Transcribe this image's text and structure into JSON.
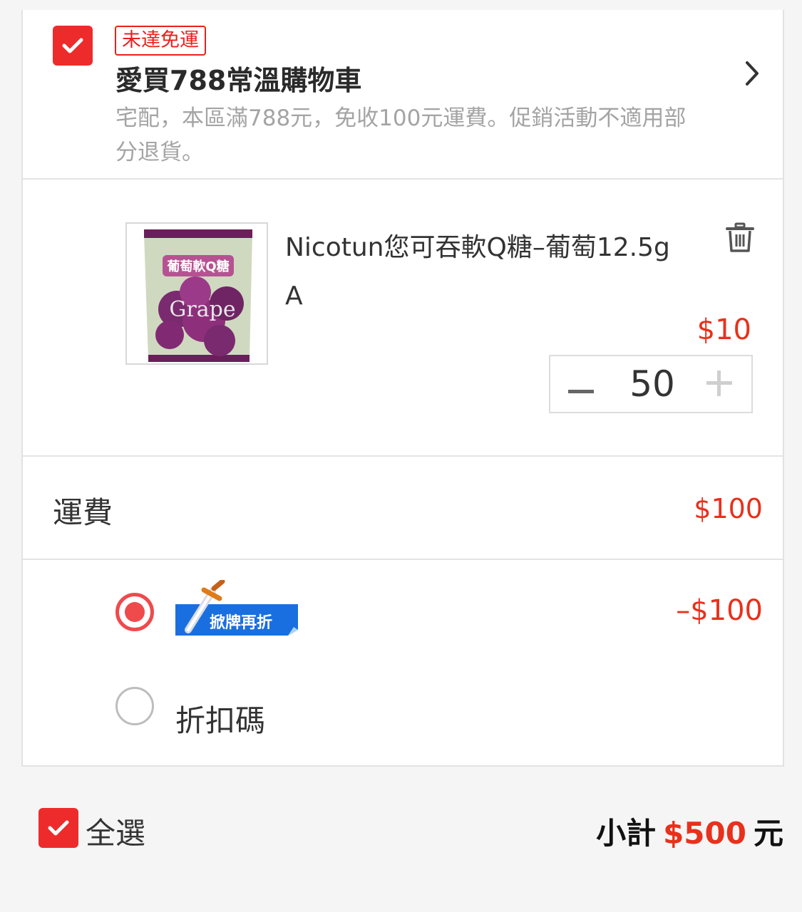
{
  "store": {
    "tag": "未達免運",
    "title": "愛買788常溫購物車",
    "description": "宅配，本區滿788元，免收100元運費。促銷活動不適用部分退貨。",
    "checked": true
  },
  "product": {
    "name": "Nicotun您可吞軟Q糖–葡萄12.5g",
    "variant": "A",
    "price": "$10",
    "quantity": "50",
    "image_text": "Grape"
  },
  "shipping": {
    "label": "運費",
    "value": "$100"
  },
  "discount_options": [
    {
      "badge_text": "掀牌再折",
      "amount": "–$100",
      "selected": true
    },
    {
      "label": "折扣碼",
      "selected": false
    }
  ],
  "footer": {
    "select_all_label": "全選",
    "subtotal_label": "小計",
    "subtotal_amount": "$500",
    "subtotal_unit": "元"
  },
  "colors": {
    "accent_red": "#ee2b2b",
    "price_red": "#e8311c",
    "badge_blue": "#1a73e8"
  },
  "icons": {
    "store_checkbox": "check-icon",
    "chevron": "chevron-right-icon",
    "delete": "trash-icon",
    "minus": "minus-icon",
    "plus": "plus-icon",
    "promo": "sword-icon"
  }
}
